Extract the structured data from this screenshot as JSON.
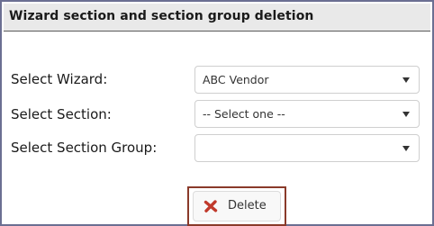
{
  "panel": {
    "title": "Wizard section and section group deletion"
  },
  "form": {
    "wizard": {
      "label": "Select Wizard:",
      "value": "ABC Vendor"
    },
    "section": {
      "label": "Select Section:",
      "value": "-- Select one --"
    },
    "section_group": {
      "label": "Select Section Group:",
      "value": ""
    }
  },
  "actions": {
    "delete_label": "Delete",
    "delete_icon": "x-icon",
    "delete_icon_color": "#c0392b",
    "highlight_color": "#8a3a2a"
  }
}
